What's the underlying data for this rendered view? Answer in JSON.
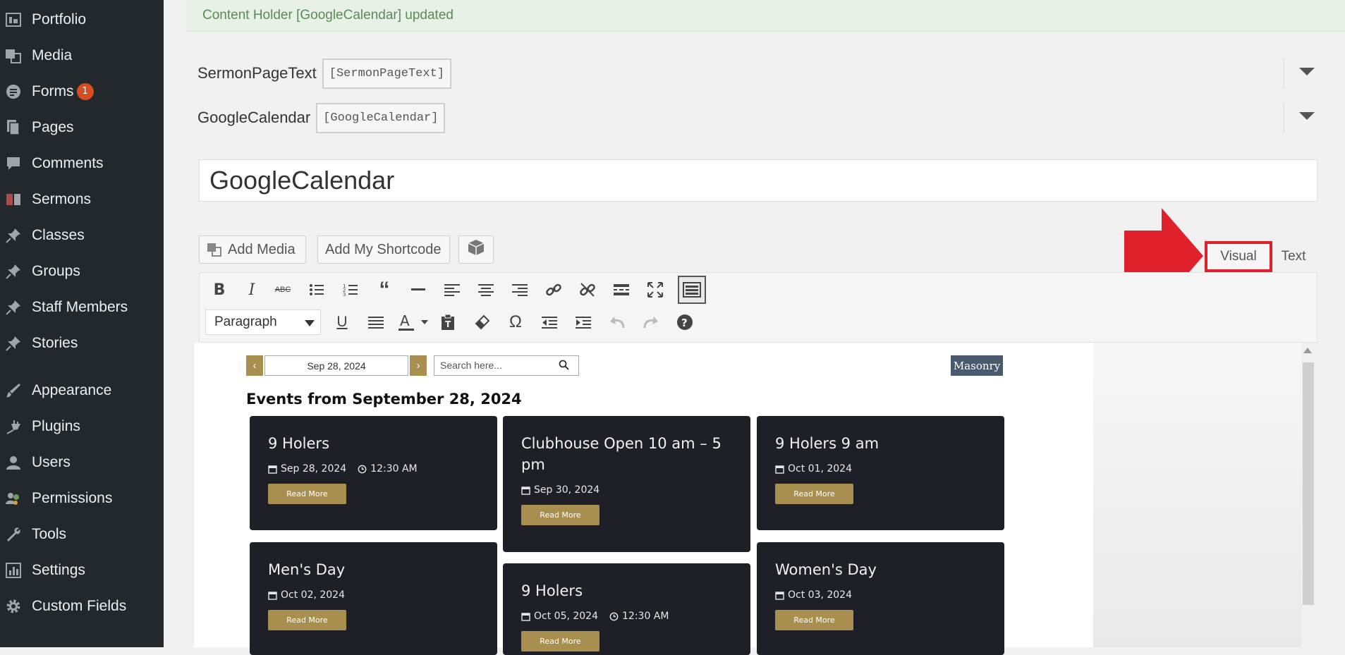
{
  "sidebar": {
    "items": [
      {
        "label": "Portfolio",
        "icon": "portfolio-icon"
      },
      {
        "label": "Media",
        "icon": "media-icon"
      },
      {
        "label": "Forms",
        "icon": "forms-icon",
        "badge": "1"
      },
      {
        "label": "Pages",
        "icon": "pages-icon"
      },
      {
        "label": "Comments",
        "icon": "comments-icon"
      },
      {
        "label": "Sermons",
        "icon": "sermons-icon"
      },
      {
        "label": "Classes",
        "icon": "pin-icon"
      },
      {
        "label": "Groups",
        "icon": "pin-icon"
      },
      {
        "label": "Staff Members",
        "icon": "pin-icon"
      },
      {
        "label": "Stories",
        "icon": "pin-icon"
      },
      {
        "label": "Appearance",
        "icon": "appearance-icon"
      },
      {
        "label": "Plugins",
        "icon": "plugins-icon"
      },
      {
        "label": "Users",
        "icon": "users-icon"
      },
      {
        "label": "Permissions",
        "icon": "permissions-icon"
      },
      {
        "label": "Tools",
        "icon": "wrench-icon"
      },
      {
        "label": "Settings",
        "icon": "settings-icon"
      },
      {
        "label": "Custom Fields",
        "icon": "gear-icon"
      }
    ]
  },
  "notice": {
    "text": "Content Holder [GoogleCalendar] updated"
  },
  "content_holders": [
    {
      "name": "SermonPageText",
      "shortcode": "[SermonPageText]"
    },
    {
      "name": "GoogleCalendar",
      "shortcode": "[GoogleCalendar]"
    }
  ],
  "title_input": {
    "value": "GoogleCalendar"
  },
  "media_buttons": {
    "add_media": "Add Media",
    "add_shortcode": "Add My Shortcode"
  },
  "editor_tabs": {
    "visual": "Visual",
    "text": "Text",
    "active": "visual"
  },
  "toolbar": {
    "format_value": "Paragraph"
  },
  "calendar": {
    "date_value": "Sep 28, 2024",
    "search_placeholder": "Search here...",
    "view_button": "Masonry",
    "heading": "Events from September 28, 2024",
    "events": [
      {
        "title": "9 Holers",
        "date": "Sep 28, 2024",
        "time": "12:30 AM",
        "button": "Read More"
      },
      {
        "title": "Clubhouse Open 10 am – 5 pm",
        "date": "Sep 30, 2024",
        "time": "",
        "button": "Read More"
      },
      {
        "title": "9 Holers 9 am",
        "date": "Oct 01, 2024",
        "time": "",
        "button": "Read More"
      },
      {
        "title": "Men's Day",
        "date": "Oct 02, 2024",
        "time": "",
        "button": "Read More"
      },
      {
        "title": "9 Holers",
        "date": "Oct 05, 2024",
        "time": "12:30 AM",
        "button": "Read More"
      },
      {
        "title": "Women's Day",
        "date": "Oct 03, 2024",
        "time": "",
        "button": "Read More"
      }
    ]
  },
  "colors": {
    "sidebar_bg": "#23282d",
    "accent_gold": "#a88f4f",
    "card_bg": "#1f1f27",
    "highlight_red": "#e0202a"
  }
}
